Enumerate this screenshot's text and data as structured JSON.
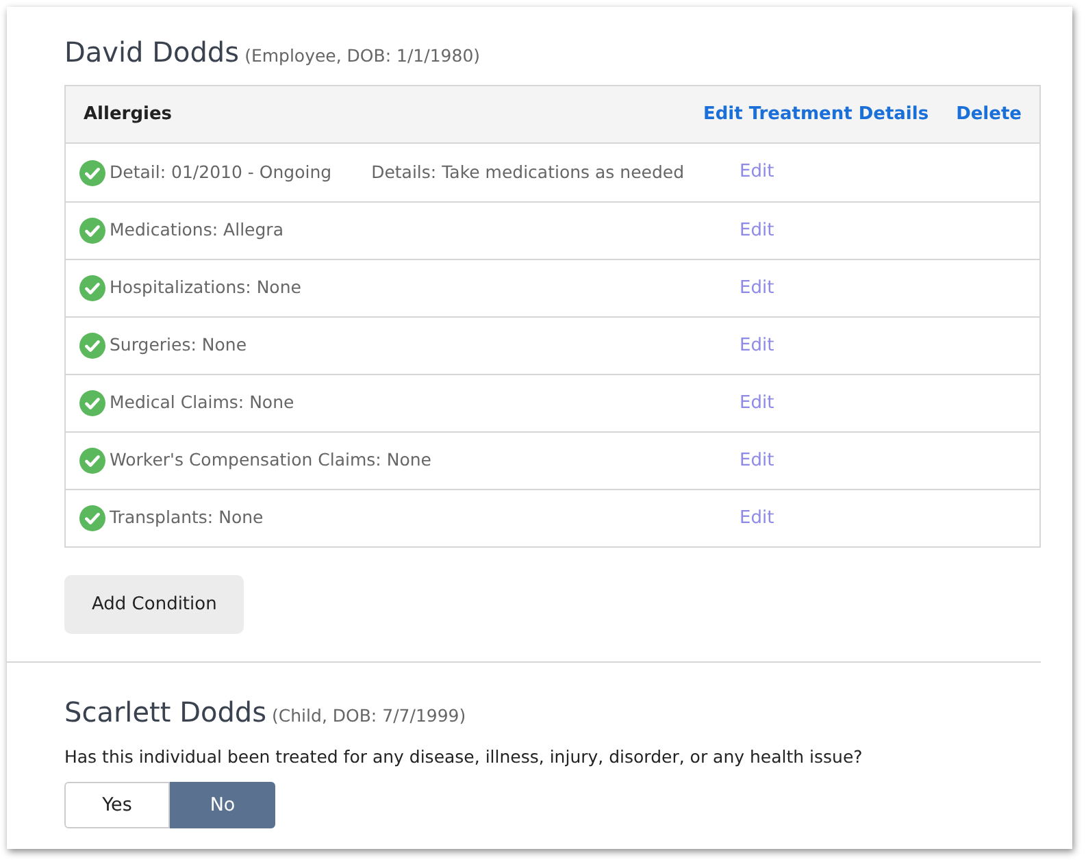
{
  "person": {
    "name": "David Dodds",
    "info": "(Employee, DOB: 1/1/1980)"
  },
  "table": {
    "title": "Allergies",
    "actions": [
      "Edit Treatment Details",
      "Delete"
    ],
    "rows": [
      {
        "text": "Detail: 01/2010 - Ongoing",
        "details": "Details: Take medications as needed",
        "complete": true,
        "action": "Edit"
      },
      {
        "text": "Medications: Allegra",
        "complete": true,
        "action": "Edit"
      },
      {
        "text": "Hospitalizations: None",
        "complete": true,
        "action": "Edit"
      },
      {
        "text": "Surgeries: None",
        "complete": true,
        "action": "Edit"
      },
      {
        "text": "Medical Claims: None",
        "complete": true,
        "action": "Edit"
      },
      {
        "text": "Worker's Compensation Claims: None",
        "complete": true,
        "action": "Edit"
      },
      {
        "text": "Transplants: None",
        "complete": true,
        "action": "Edit"
      }
    ]
  },
  "add_button": "Add Condition",
  "second_person": {
    "name": "Scarlett Dodds",
    "info": "(Child, DOB: 7/7/1999)"
  },
  "question": "Has this individual been treated for any disease, illness, injury, disorder, or any health issue?",
  "answers": [
    {
      "label": "Yes",
      "selected": false
    },
    {
      "label": "No",
      "selected": true
    }
  ]
}
